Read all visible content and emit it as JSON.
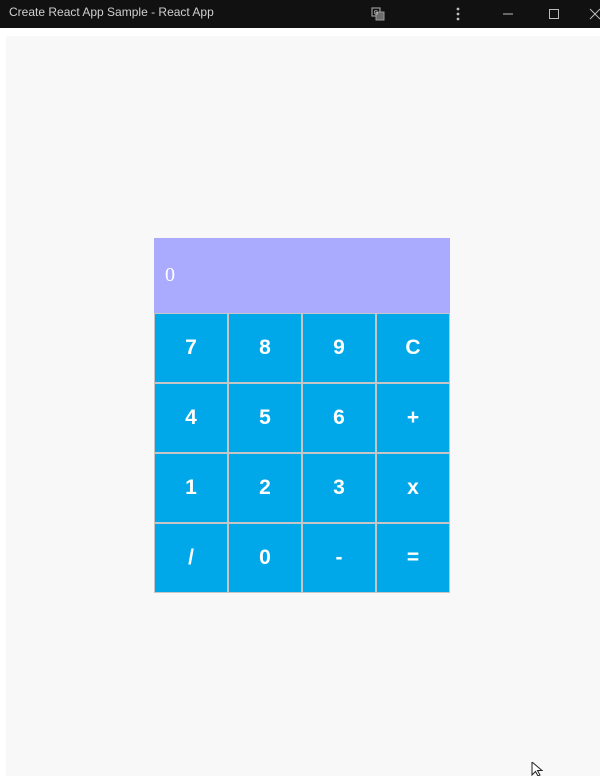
{
  "window": {
    "title": "Create React App Sample - React App"
  },
  "icons": {
    "translate": "translate-icon",
    "menu": "more-vertical-icon",
    "minimize": "minimize-icon",
    "maximize": "maximize-icon",
    "close": "close-icon",
    "cursor": "mouse-pointer-icon"
  },
  "colors": {
    "display_bg": "#aaaaff",
    "key_bg": "#00a8ea",
    "page_bg": "#f8f8f9"
  },
  "calculator": {
    "display_value": "0",
    "keys": [
      "7",
      "8",
      "9",
      "C",
      "4",
      "5",
      "6",
      "+",
      "1",
      "2",
      "3",
      "x",
      "/",
      "0",
      "-",
      "="
    ]
  }
}
